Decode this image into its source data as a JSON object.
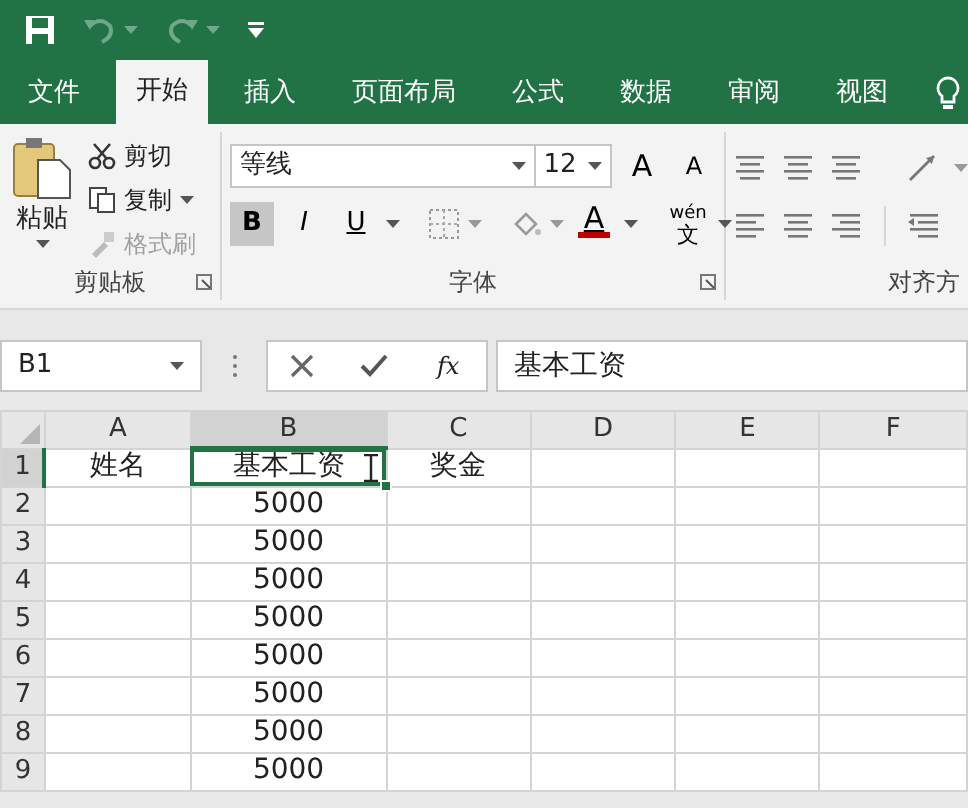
{
  "tabs": [
    {
      "label": "文件",
      "selected": false
    },
    {
      "label": "开始",
      "selected": true
    },
    {
      "label": "插入",
      "selected": false
    },
    {
      "label": "页面布局",
      "selected": false
    },
    {
      "label": "公式",
      "selected": false
    },
    {
      "label": "数据",
      "selected": false
    },
    {
      "label": "审阅",
      "selected": false
    },
    {
      "label": "视图",
      "selected": false
    }
  ],
  "clipboard": {
    "label": "剪贴板",
    "paste": "粘贴",
    "cut": "剪切",
    "copy": "复制",
    "format_painter": {
      "label": "格式刷",
      "disabled": true
    }
  },
  "font": {
    "label": "字体",
    "font_name": "等线",
    "font_size": "12",
    "grow": "A",
    "shrink": "A",
    "bold": {
      "label": "B",
      "on": true
    },
    "italic": {
      "label": "I",
      "on": false
    },
    "underline": {
      "label": "U",
      "on": false
    },
    "font_color": "A",
    "phonetic_top": "wén",
    "phonetic_bottom": "文"
  },
  "alignment": {
    "label": "对齐方"
  },
  "formula_bar": {
    "name_box": "B1",
    "fx": "fx",
    "value": "基本工资"
  },
  "sheet": {
    "columns": [
      {
        "label": "A",
        "selected": false
      },
      {
        "label": "B",
        "selected": true
      },
      {
        "label": "C",
        "selected": false
      },
      {
        "label": "D",
        "selected": false
      },
      {
        "label": "E",
        "selected": false
      },
      {
        "label": "F",
        "selected": false
      }
    ],
    "rows": [
      {
        "header": "1",
        "selected": true,
        "cells": [
          "姓名",
          "基本工资",
          "奖金",
          null,
          null,
          null
        ]
      },
      {
        "header": "2",
        "selected": false,
        "cells": [
          null,
          "5000",
          null,
          null,
          null,
          null
        ]
      },
      {
        "header": "3",
        "selected": false,
        "cells": [
          null,
          "5000",
          null,
          null,
          null,
          null
        ]
      },
      {
        "header": "4",
        "selected": false,
        "cells": [
          null,
          "5000",
          null,
          null,
          null,
          null
        ]
      },
      {
        "header": "5",
        "selected": false,
        "cells": [
          null,
          "5000",
          null,
          null,
          null,
          null
        ]
      },
      {
        "header": "6",
        "selected": false,
        "cells": [
          null,
          "5000",
          null,
          null,
          null,
          null
        ]
      },
      {
        "header": "7",
        "selected": false,
        "cells": [
          null,
          "5000",
          null,
          null,
          null,
          null
        ]
      },
      {
        "header": "8",
        "selected": false,
        "cells": [
          null,
          "5000",
          null,
          null,
          null,
          null
        ]
      },
      {
        "header": "9",
        "selected": false,
        "cells": [
          null,
          "5000",
          null,
          null,
          null,
          null
        ]
      }
    ]
  }
}
